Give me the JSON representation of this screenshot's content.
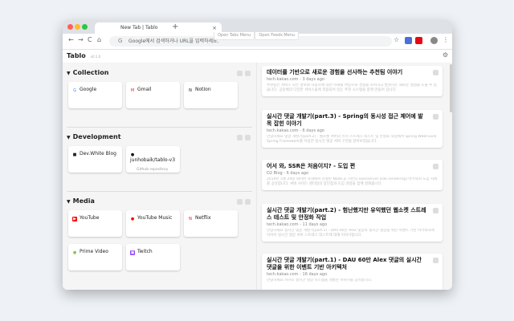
{
  "browser": {
    "tab_title": "New Tab | Tablo",
    "tab_close": "×",
    "new_tab": "+",
    "back": "←",
    "forward": "→",
    "reload": "C",
    "home": "⌂",
    "omnibox_placeholder": "Google에서 검색하거나 URL을 입력하세요.",
    "omnibox_g": "G",
    "bookmark_star": "☆",
    "menu_dots": "⋮"
  },
  "app": {
    "logo": "Tablo",
    "version": "v0.1.0",
    "menu_left": "Open Tabs Menu",
    "menu_right": "Open Feeds Menu",
    "settings_icon": "⚙"
  },
  "collections": [
    {
      "title": "Collection",
      "items": [
        {
          "label": "Google",
          "icon_char": "G",
          "icon_color": "#ffffff",
          "icon_fg": "#4285f4",
          "sub": ""
        },
        {
          "label": "Gmail",
          "icon_char": "M",
          "icon_color": "#ffffff",
          "icon_fg": "#d93025",
          "sub": ""
        },
        {
          "label": "Notion",
          "icon_char": "N",
          "icon_color": "#ffffff",
          "icon_fg": "#111111",
          "sub": ""
        }
      ]
    },
    {
      "title": "Development",
      "items": [
        {
          "label": "Dev.White Blog",
          "icon_char": "■",
          "icon_color": "#ffffff",
          "icon_fg": "#222222",
          "sub": ""
        },
        {
          "label": "junhobaik/tablo-v3",
          "icon_char": "●",
          "icon_color": "#ffffff",
          "icon_fg": "#111111",
          "sub": "Github repository"
        }
      ]
    },
    {
      "title": "Media",
      "items": [
        {
          "label": "YouTube",
          "icon_char": "▶",
          "icon_color": "#ff0000",
          "icon_fg": "#ffffff",
          "sub": ""
        },
        {
          "label": "YouTube Music",
          "icon_char": "●",
          "icon_color": "#ffffff",
          "icon_fg": "#ff0000",
          "sub": ""
        },
        {
          "label": "Netflix",
          "icon_char": "N",
          "icon_color": "#ffffff",
          "icon_fg": "#e50914",
          "sub": ""
        },
        {
          "label": "Prime Video",
          "icon_char": "●",
          "icon_color": "#ffffff",
          "icon_fg": "#8bc34a",
          "sub": ""
        },
        {
          "label": "Twitch",
          "icon_char": "▣",
          "icon_color": "#9146ff",
          "icon_fg": "#ffffff",
          "sub": ""
        }
      ]
    }
  ],
  "feeds": [
    {
      "title": "데이터를 기반으로 새로운 경험을 선사하는 추천팀 이야기",
      "meta": "tech.kakao.com - 3 days ago",
      "body": "추천팀은 서비스 모든 정보와 사용자에 대한 이해를 바탕으로 경험을 소비하고 발견하는 새로운 경험을 도울 수 있습니다. 공동체의 다양한 서비스들에 적용되어 있는 추천 시스템을 함께 만들어 갑니다."
    },
    {
      "title": "실시간 댓글 개발기(part.3) - Spring의 동시성 접근 제어에 발목 잡힌 이야기",
      "meta": "tech.kakao.com - 6 days ago",
      "body": "안녕하세요 댓글 개발기(part.2) - 웹소켓 서버의 유저 스트레스 테스트 및 안정화 작업에서 Spring WebFlux와 Spring Framework를 이용한 실시간 댓글 서버 구현을 알아보았습니다."
    },
    {
      "title": "어서 와, SSR은 처음이지? - 도입 편",
      "meta": "D2 Blog - 6 days ago",
      "body": "2019년 5월 29일 네이버 사내에서 진행된 Node.js 기반의 SSR(server side rendering) 아키텍처 도입 사례를 공유합니다. 서버 사이드 렌더링의 장단점과 도입 과정을 함께 살펴봅니다."
    },
    {
      "title": "실시간 댓글 개발기(part.2) - 험난했지만 유익했던 웹소켓 스트레스 테스트 및 안정화 작업",
      "meta": "tech.kakao.com - 11 days ago",
      "body": "안녕하세요 실시간 댓글 개발기(part.1) - DAU 60만 Alex 댓글의 실시간 댓글을 위한 이벤트 기반 아키텍처에 이어서 실시간 댓글 서버 스트레스 테스트에 대해 이야기합니다."
    },
    {
      "title": "실시간 댓글 개발기(part.1) - DAU 60만 Alex 댓글의 실시간 댓글을 위한 이벤트 기반 아키텍처",
      "meta": "tech.kakao.com - 16 days ago",
      "body": "안녕하세요 카카오 실시간 댓글 시스템을 개발한 이야기를 공유합니다."
    }
  ]
}
